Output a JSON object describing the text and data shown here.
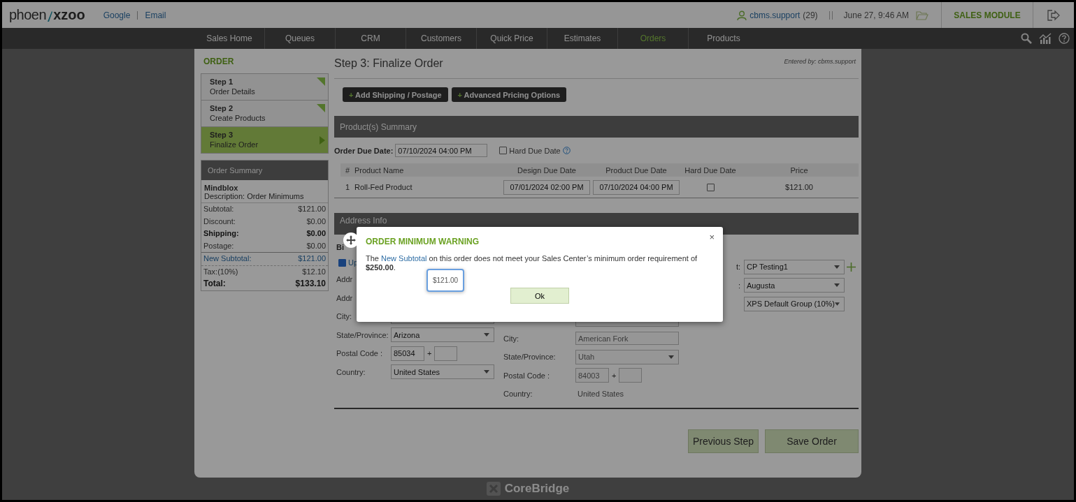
{
  "header": {
    "logo_light": "phoen",
    "logo_bold": "xzoo",
    "links": [
      "Google",
      "Email"
    ],
    "user": "cbms.support",
    "user_count": "(29)",
    "datetime": "June 27, 9:46 AM",
    "module": "SALES MODULE"
  },
  "nav": [
    {
      "label": "Sales Home",
      "selected": false
    },
    {
      "label": "Queues",
      "selected": false
    },
    {
      "label": "CRM",
      "selected": false
    },
    {
      "label": "Customers",
      "selected": false
    },
    {
      "label": "Quick Price",
      "selected": false
    },
    {
      "label": "Estimates",
      "selected": false
    },
    {
      "label": "Orders",
      "selected": true
    },
    {
      "label": "Products",
      "selected": false
    }
  ],
  "sidebar": {
    "title": "ORDER",
    "steps": [
      {
        "step": "Step 1",
        "label": "Order Details",
        "selected": false,
        "completed": true
      },
      {
        "step": "Step 2",
        "label": "Create Products",
        "selected": false,
        "completed": true
      },
      {
        "step": "Step 3",
        "label": "Finalize Order",
        "selected": true,
        "completed": false
      }
    ],
    "summary": {
      "title": "Order Summary",
      "company": "Mindblox",
      "description_label": "Description:",
      "description": "Order Minimums",
      "lines": [
        {
          "label": "Subtotal:",
          "value": "$121.00",
          "kind": "plain"
        },
        {
          "label": "Discount:",
          "value": "$0.00",
          "kind": "plain"
        },
        {
          "label": "Shipping:",
          "value": "$0.00",
          "kind": "bold"
        },
        {
          "label": "Postage:",
          "value": "$0.00",
          "kind": "plain"
        },
        {
          "label": "New Subtotal:",
          "value": "$121.00",
          "kind": "link"
        },
        {
          "label": "Tax:(10%)",
          "value": "$12.10",
          "kind": "tax"
        },
        {
          "label": "Total:",
          "value": "$133.10",
          "kind": "total"
        }
      ]
    }
  },
  "main": {
    "title": "Step 3: Finalize Order",
    "entered_by": "Entered by: cbms.support",
    "actions": [
      {
        "icon": "+",
        "label": "Add Shipping / Postage"
      },
      {
        "icon": "+",
        "label": "Advanced Pricing Options"
      }
    ],
    "products": {
      "title": "Product(s) Summary",
      "due_label": "Order Due Date:",
      "due_value": "07/10/2024 04:00 PM",
      "hard_due_label": "Hard Due Date",
      "hard_due_checked": false,
      "columns": [
        "#",
        "Product Name",
        "Design Due Date",
        "Product Due Date",
        "Hard Due Date",
        "Price"
      ],
      "rows": [
        {
          "num": "1",
          "name": "Roll-Fed Product",
          "design_due": "07/01/2024 02:00 PM",
          "product_due": "07/10/2024 04:00 PM",
          "hard_due": false,
          "price": "$121.00"
        }
      ]
    },
    "address": {
      "title": "Address Info",
      "billing_label": "Bi",
      "update": {
        "label": "Up",
        "checked": true
      },
      "billing_fields": [
        {
          "label": "Addr",
          "kind": "hidden"
        },
        {
          "label": "Addr",
          "kind": "hidden"
        },
        {
          "label": "City:",
          "kind": "input"
        },
        {
          "label": "State/Province:",
          "kind": "select",
          "value": "Arizona"
        },
        {
          "label": "Postal Code :",
          "kind": "postal",
          "value": "85034"
        },
        {
          "label": "Country:",
          "kind": "select",
          "value": "United States"
        }
      ],
      "shipping_fields": [
        {
          "kind": "input"
        },
        {
          "label": "City:",
          "kind": "input",
          "value": "American Fork"
        },
        {
          "label": "State/Province:",
          "kind": "select",
          "value": "Utah"
        },
        {
          "label": "Postal Code :",
          "kind": "postal",
          "value": "84003"
        },
        {
          "label": "Country:",
          "kind": "text",
          "value": "United States"
        }
      ],
      "other_fields": [
        {
          "label": "t:",
          "value": "CP Testing1",
          "add": true
        },
        {
          "label": ":",
          "value": "Augusta",
          "add": false
        },
        {
          "value": "XPS Default Group (10%)",
          "add": false
        }
      ]
    },
    "buttons": [
      "Previous Step",
      "Save Order"
    ]
  },
  "footer": {
    "brand": "CoreBridge"
  },
  "modal": {
    "title": "ORDER MINIMUM WARNING",
    "text_before": "The",
    "link": "New Subtotal",
    "text_after": "on this order does not meet your Sales Center’s minimum order requirement of **$250.00**.",
    "tooltip": "$121.00",
    "button": "Ok",
    "close": "×"
  }
}
